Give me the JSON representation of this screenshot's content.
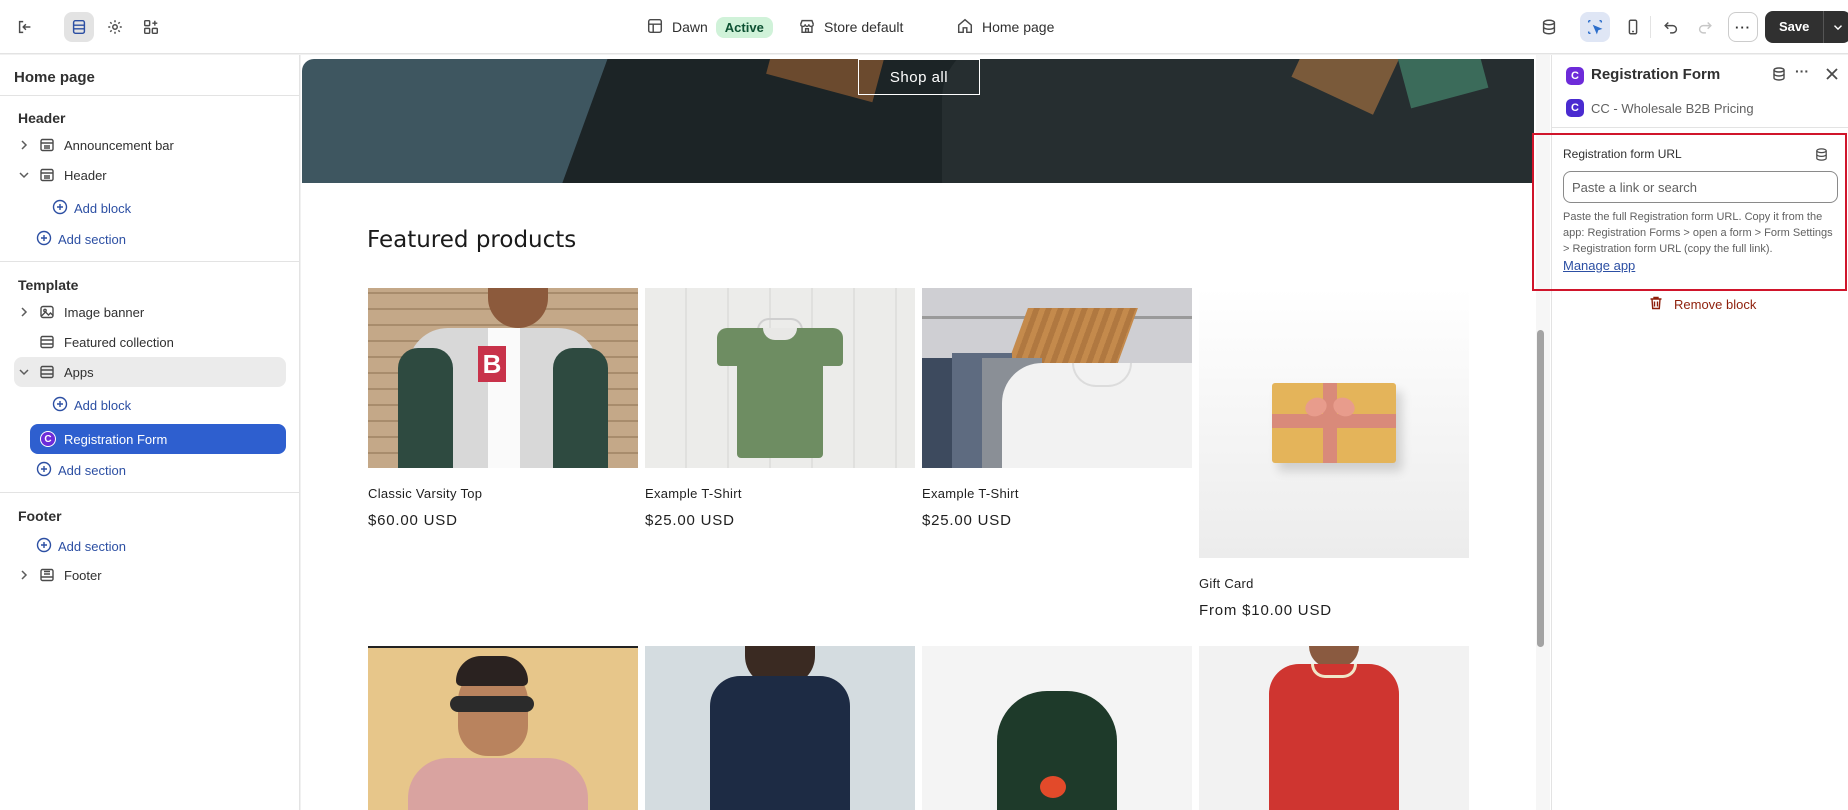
{
  "topbar": {
    "theme_name": "Dawn",
    "theme_status": "Active",
    "store": "Store default",
    "page": "Home page",
    "save_label": "Save",
    "more_label": "···"
  },
  "sidebar": {
    "title": "Home page",
    "header_group": "Header",
    "announcement_bar": "Announcement bar",
    "header_item": "Header",
    "add_block": "Add block",
    "add_section": "Add section",
    "template_group": "Template",
    "image_banner": "Image banner",
    "featured_collection": "Featured collection",
    "apps": "Apps",
    "registration_form": "Registration Form",
    "footer_group": "Footer",
    "footer_item": "Footer"
  },
  "preview": {
    "shop_all": "Shop all",
    "featured_title": "Featured products",
    "products": [
      {
        "name": "Classic Varsity Top",
        "price": "$60.00 USD"
      },
      {
        "name": "Example T-Shirt",
        "price": "$25.00 USD"
      },
      {
        "name": "Example T-Shirt",
        "price": "$25.00 USD"
      },
      {
        "name": "Gift Card",
        "price": "From $10.00 USD"
      }
    ]
  },
  "panel": {
    "title": "Registration Form",
    "app_name": "CC - Wholesale B2B Pricing",
    "field_label": "Registration form URL",
    "input_placeholder": "Paste a link or search",
    "input_value": "",
    "help_text": "Paste the full Registration form URL. Copy it from the app: Registration Forms > open a form > Form Settings > Registration form URL (copy the full link).",
    "manage_link": "Manage app",
    "remove_block": "Remove block"
  },
  "colors": {
    "accent": "#2e5fcf",
    "active_badge": "#d0f2d9",
    "highlight_border": "#d0152b",
    "danger": "#8e1f0b",
    "app_brand": "#6d2bd9"
  },
  "icons": {
    "exit": "exit-icon",
    "sections": "sections-icon",
    "settings": "gear-icon",
    "apps": "apps-icon",
    "layout": "layout-icon",
    "store": "store-icon",
    "home": "home-icon",
    "database": "database-icon",
    "inspect": "inspect-icon",
    "mobile": "mobile-icon",
    "undo": "undo-icon",
    "redo": "redo-icon",
    "trash": "trash-icon",
    "close": "close-icon"
  }
}
